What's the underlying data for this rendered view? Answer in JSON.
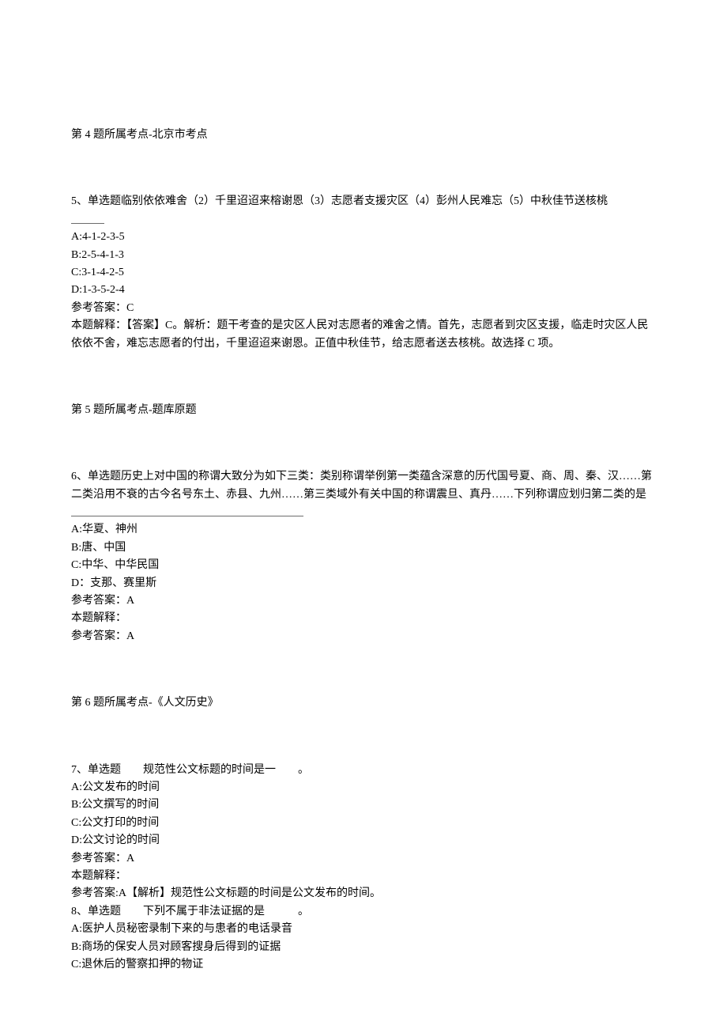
{
  "q4_topic": "第 4 题所属考点-北京市考点",
  "q5": {
    "stem": "5、单选题临别依依难舍（2）千里迢迢来榕谢恩（3）志愿者支援灾区（4）彭州人民难忘（5）中秋佳节送核桃",
    "blank": "＿＿＿",
    "optA": "A:4-1-2-3-5",
    "optB": "B:2-5-4-1-3",
    "optC": "C:3-1-4-2-5",
    "optD": "D:1-3-5-2-4",
    "ans": "参考答案：C",
    "exp": "本题解释：【答案】C。解析：题干考查的是灾区人民对志愿者的难舍之情。首先，志愿者到灾区支援，临走时灾区人民依依不舍，难忘志愿者的付出，千里迢迢来谢恩。正值中秋佳节，给志愿者送去核桃。故选择 C 项。"
  },
  "q5_topic": "第 5 题所属考点-题库原题",
  "q6": {
    "stem": "6、单选题历史上对中国的称谓大致分为如下三类：类别称谓举例第一类蕴含深意的历代国号夏、商、周、秦、汉……第二类沿用不衰的古今名号东土、赤县、九州……第三类域外有关中国的称谓震旦、真丹……下列称谓应划归第二类的是",
    "blank": "＿＿＿＿＿＿＿＿＿＿＿＿＿＿＿＿＿＿＿＿＿",
    "optA": "A:华夏、神州",
    "optB": "B:唐、中国",
    "optC": "C:中华、中华民国",
    "optD": "D：支那、赛里斯",
    "ans": "参考答案：A",
    "exp1": "本题解释：",
    "exp2": "参考答案：A"
  },
  "q6_topic": "第 6 题所属考点-《人文历史》",
  "q7": {
    "stem_a": "7、单选题　　规范性公文标题的时间是一　　。",
    "optA": "A:公文发布的时间",
    "optB": "B:公文撰写的时间",
    "optC": "C:公文打印的时间",
    "optD": "D:公文讨论的时间",
    "ans": "参考答案：A",
    "exp1": "本题解释：",
    "exp2": "参考答案:A【解析】规范性公文标题的时间是公文发布的时间。"
  },
  "q8": {
    "stem": "8、单选题　　下列不属于非法证据的是　　　。",
    "optA": "A:医护人员秘密录制下来的与患者的电话录音",
    "optB": "B:商场的保安人员对顾客搜身后得到的证据",
    "optC": "C:退休后的警察扣押的物证"
  }
}
